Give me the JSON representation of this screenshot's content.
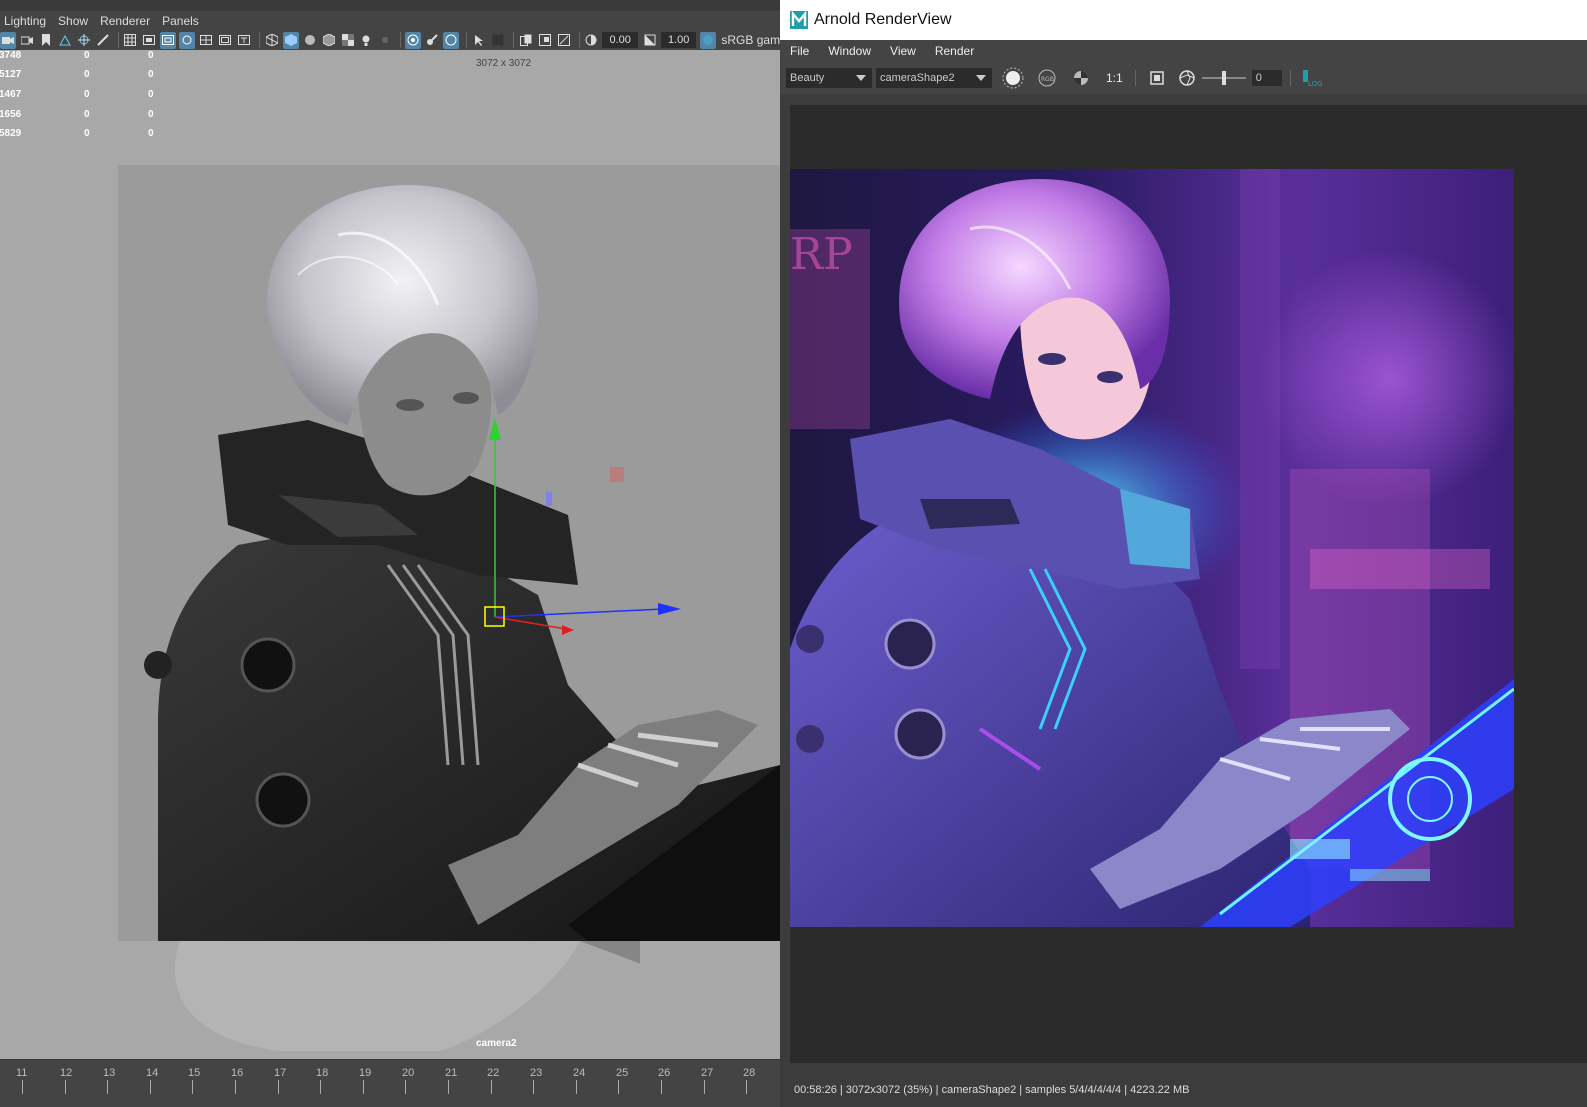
{
  "maya": {
    "menu": [
      "Lighting",
      "Show",
      "Renderer",
      "Panels"
    ],
    "toolbar": {
      "exposure": "0.00",
      "gamma": "1.00",
      "colorspace": "sRGB gam"
    },
    "hud": [
      {
        "id": "3748",
        "v1": "0",
        "v2": "0"
      },
      {
        "id": "5127",
        "v1": "0",
        "v2": "0"
      },
      {
        "id": "1467",
        "v1": "0",
        "v2": "0"
      },
      {
        "id": "1656",
        "v1": "0",
        "v2": "0"
      },
      {
        "id": "5829",
        "v1": "0",
        "v2": "0"
      }
    ],
    "resolution": "3072 x 3072",
    "camera": "camera2",
    "timeline": [
      "11",
      "12",
      "13",
      "14",
      "15",
      "16",
      "17",
      "18",
      "19",
      "20",
      "21",
      "22",
      "23",
      "24",
      "25",
      "26",
      "27",
      "28"
    ]
  },
  "arnold": {
    "title": "Arnold RenderView",
    "menu": [
      "File",
      "Window",
      "View",
      "Render"
    ],
    "aov": "Beauty",
    "camera": "cameraShape2",
    "ratio": "1:1",
    "exposure": "0",
    "log_label": "LOG",
    "status": "00:58:26 | 3072x3072 (35%) | cameraShape2  | samples 5/4/4/4/4/4 | 4223.22 MB"
  }
}
